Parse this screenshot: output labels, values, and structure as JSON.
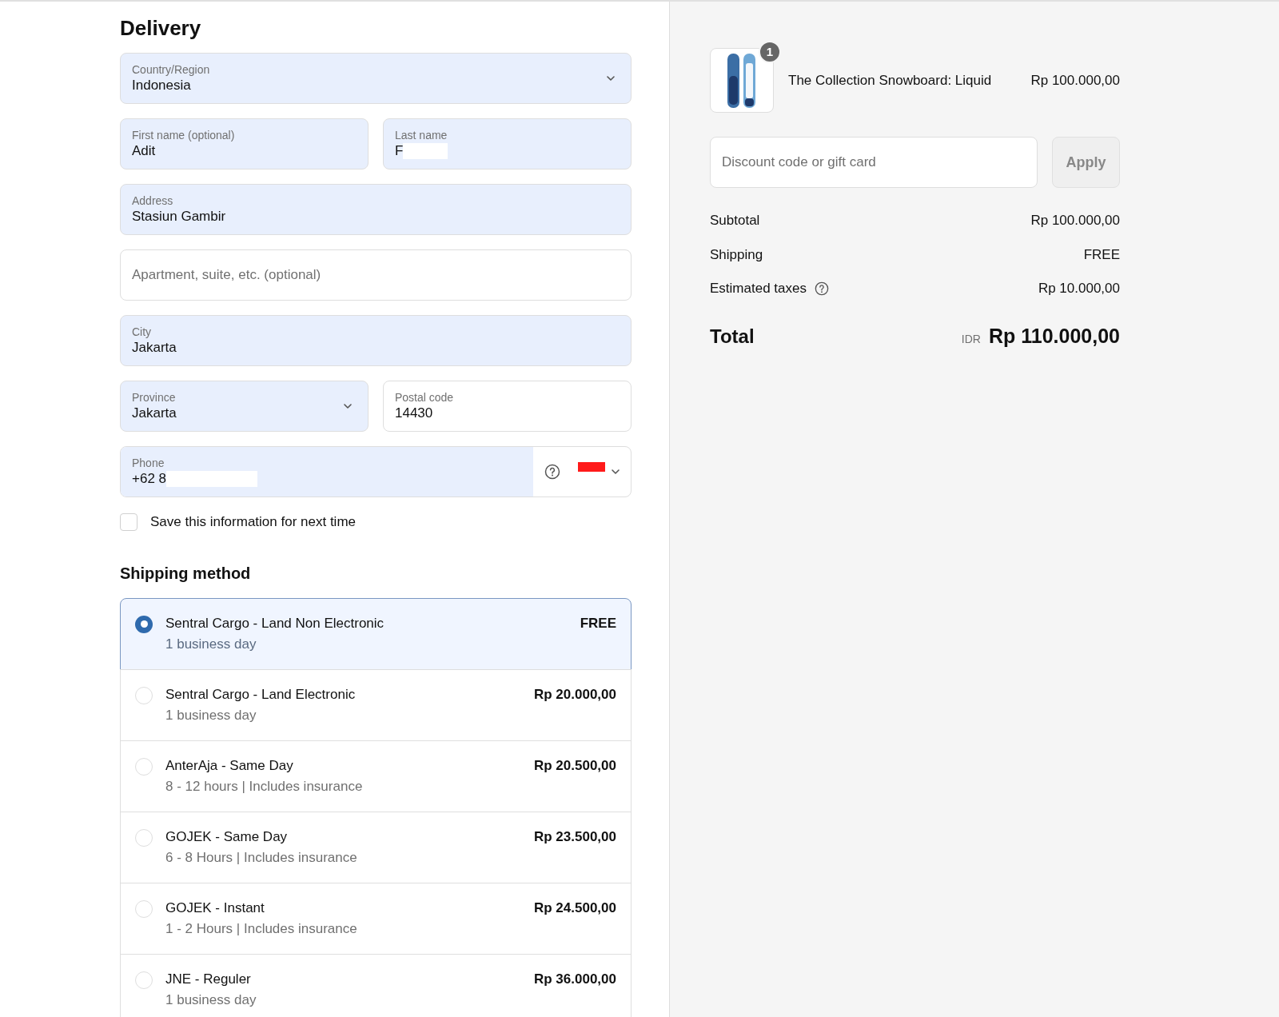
{
  "heading": "Delivery",
  "field_rows": [
    [
      {
        "kind": "select",
        "label": "Country/Region",
        "value": "Indonesia",
        "autofilled": true
      }
    ],
    [
      {
        "kind": "text",
        "label": "First name (optional)",
        "value": "Adit",
        "autofilled": true
      },
      {
        "kind": "text",
        "label": "Last name",
        "value": "F",
        "autofilled": true,
        "redacted": true
      }
    ],
    [
      {
        "kind": "text",
        "label": "Address",
        "value": "Stasiun Gambir",
        "autofilled": true
      }
    ],
    [
      {
        "kind": "text",
        "placeholder": "Apartment, suite, etc. (optional)",
        "autofilled": false
      }
    ],
    [
      {
        "kind": "text",
        "label": "City",
        "value": "Jakarta",
        "autofilled": true
      }
    ],
    [
      {
        "kind": "select",
        "label": "Province",
        "value": "Jakarta",
        "autofilled": true
      },
      {
        "kind": "text",
        "label": "Postal code",
        "value": "14430",
        "autofilled": false
      }
    ],
    [
      {
        "kind": "phone",
        "label": "Phone",
        "value": "+62 8",
        "autofilled": true,
        "redacted": true
      }
    ]
  ],
  "save_info": {
    "label": "Save this information for next time",
    "checked": false
  },
  "shipping_method": {
    "title": "Shipping method",
    "options": [
      {
        "name": "Sentral Cargo - Land Non Electronic",
        "detail": "1 business day",
        "price": "FREE",
        "selected": true
      },
      {
        "name": "Sentral Cargo - Land Electronic",
        "detail": "1 business day",
        "price": "Rp 20.000,00",
        "selected": false
      },
      {
        "name": "AnterAja - Same Day",
        "detail": "8 - 12 hours | Includes insurance",
        "price": "Rp 20.500,00",
        "selected": false
      },
      {
        "name": "GOJEK - Same Day",
        "detail": "6 - 8 Hours | Includes insurance",
        "price": "Rp 23.500,00",
        "selected": false
      },
      {
        "name": "GOJEK - Instant",
        "detail": "1 - 2 Hours | Includes insurance",
        "price": "Rp 24.500,00",
        "selected": false
      },
      {
        "name": "JNE - Reguler",
        "detail": "1 business day",
        "price": "Rp 36.000,00",
        "selected": false
      }
    ]
  },
  "order": {
    "item": {
      "quantity": "1",
      "name": "The Collection Snowboard: Liquid",
      "price": "Rp 100.000,00"
    },
    "discount": {
      "placeholder": "Discount code or gift card",
      "button": "Apply"
    },
    "lines": [
      {
        "label": "Subtotal",
        "value": "Rp 100.000,00",
        "info": false
      },
      {
        "label": "Shipping",
        "value": "FREE",
        "info": false
      },
      {
        "label": "Estimated taxes",
        "value": "Rp 10.000,00",
        "info": true
      }
    ],
    "total": {
      "label": "Total",
      "currency": "IDR",
      "value": "Rp 110.000,00"
    }
  }
}
